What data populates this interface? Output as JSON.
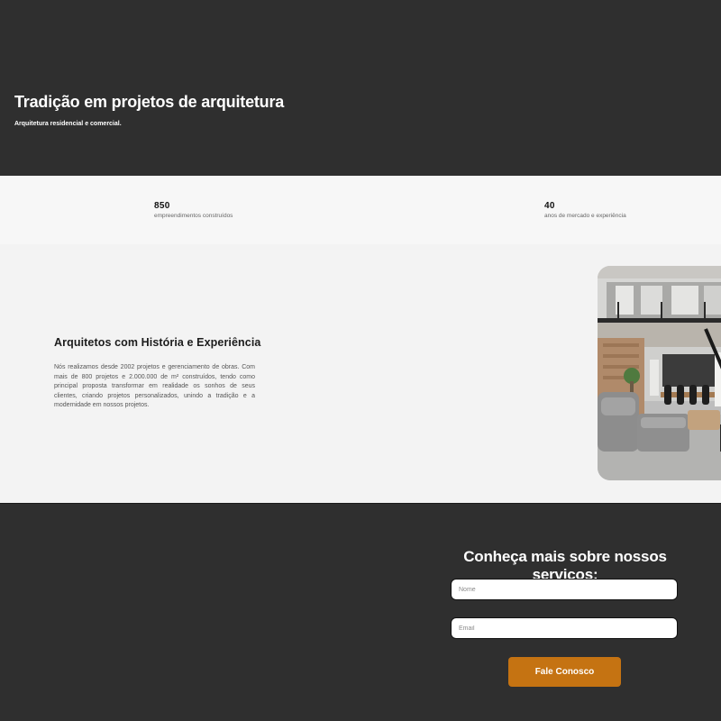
{
  "hero": {
    "title": "Tradição em projetos de arquitetura",
    "subtitle": "Arquitetura residencial e comercial."
  },
  "stats": [
    {
      "value": "850",
      "label": "empreendimentos construídos"
    },
    {
      "value": "40",
      "label": "anos de mercado e experiência"
    }
  ],
  "about": {
    "title": "Arquitetos com História e Experiência",
    "text": "Nós realizamos desde 2002 projetos e gerenciamento de obras. Com mais de 800 projetos e 2.000.000 de m² construídos, tendo como principal proposta transformar em realidade os sonhos de seus clientes, criando projetos personalizados, unindo a tradição e a modernidade em nossos projetos.",
    "image_icon": "interior-photo"
  },
  "contact": {
    "title": "Conheça mais sobre nossos serviços:",
    "name_placeholder": "Nome",
    "email_placeholder": "Email",
    "submit_label": "Fale Conosco"
  },
  "colors": {
    "dark_background": "#2f2f2f",
    "accent": "#c57312",
    "stats_background": "#f7f7f7",
    "about_background": "#f3f3f3"
  }
}
